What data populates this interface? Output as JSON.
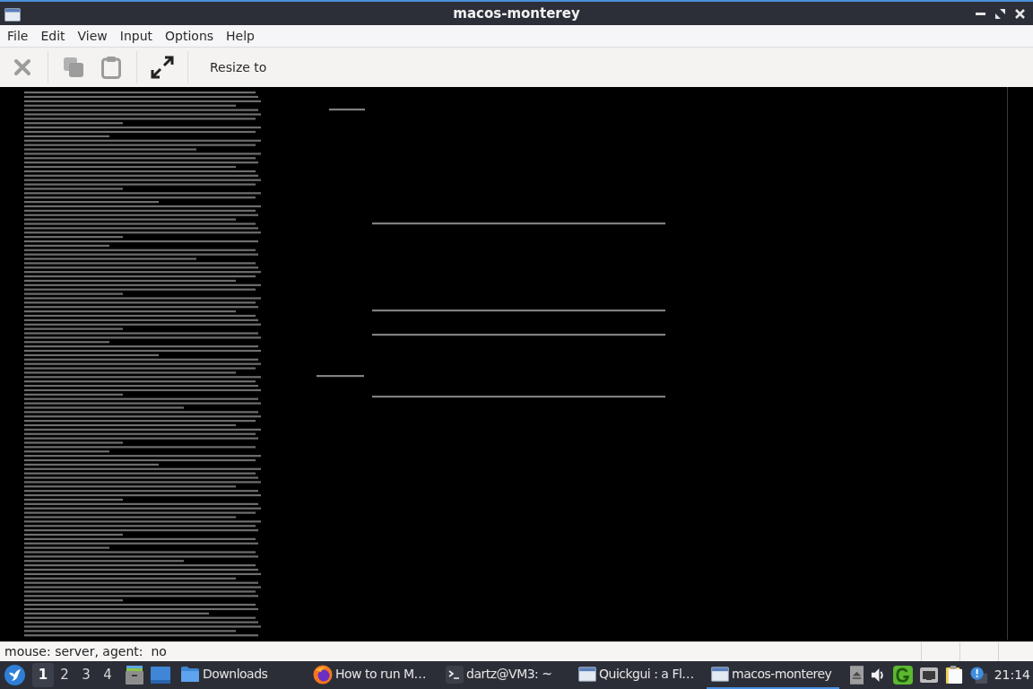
{
  "window": {
    "title": "macos-monterey"
  },
  "menu": [
    "File",
    "Edit",
    "View",
    "Input",
    "Options",
    "Help"
  ],
  "toolbar": {
    "buttons": [
      {
        "kind": "close",
        "disabled": true
      },
      {
        "kind": "copy",
        "disabled": true
      },
      {
        "kind": "paste",
        "disabled": true
      },
      {
        "kind": "fullscreen",
        "disabled": false
      }
    ],
    "resize_label": "Resize to"
  },
  "status_bar": {
    "text": "mouse: server, agent:  no"
  },
  "taskbar": {
    "workspaces": [
      {
        "label": "1",
        "selected": true
      },
      {
        "label": "2",
        "selected": false
      },
      {
        "label": "3",
        "selected": false
      },
      {
        "label": "4",
        "selected": false
      }
    ],
    "tasks": [
      {
        "kind": "folder",
        "label": "Downloads",
        "selected": false
      },
      {
        "kind": "browser",
        "label": "How to run M…",
        "selected": false
      },
      {
        "kind": "terminal",
        "label": "dartz@VM3: ~",
        "selected": false
      },
      {
        "kind": "window",
        "label": "Quickgui : a Fl…",
        "selected": false
      },
      {
        "kind": "window",
        "label": "macos-monterey",
        "selected": true
      }
    ],
    "clock": "21:14"
  }
}
